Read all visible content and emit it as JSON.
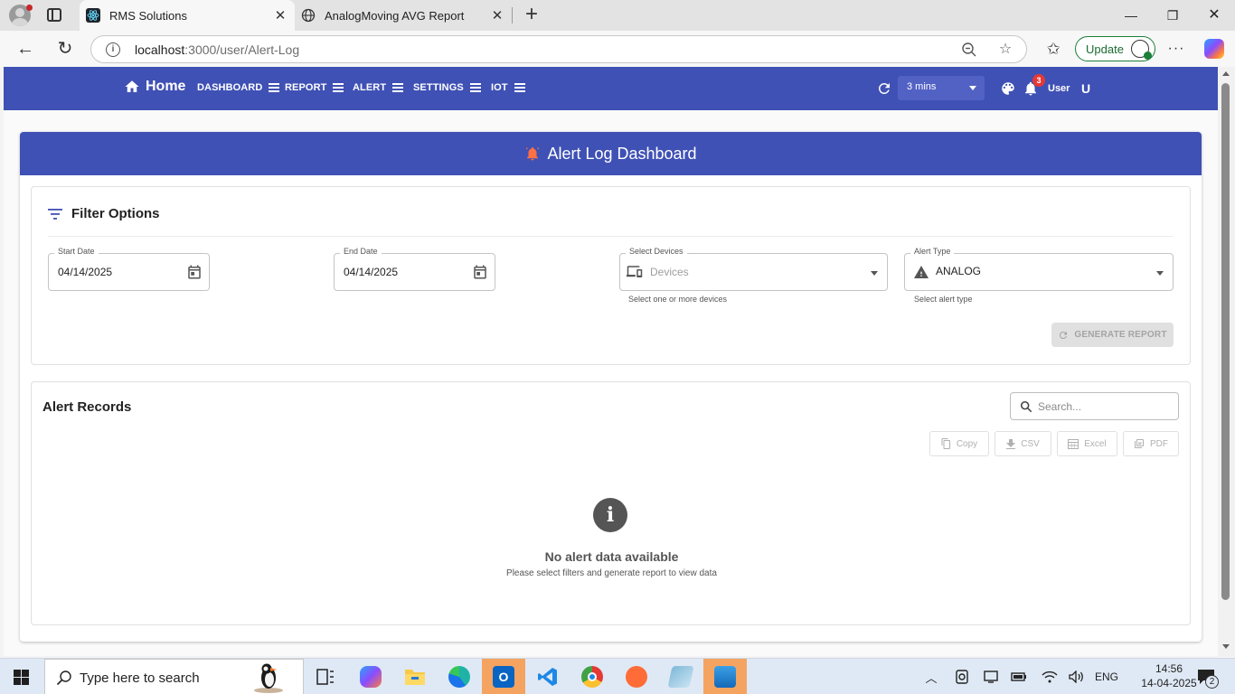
{
  "browser": {
    "tabs": [
      {
        "title": "RMS Solutions",
        "active": true,
        "icon": "react-icon"
      },
      {
        "title": "AnalogMoving AVG Report",
        "active": false,
        "icon": "globe-icon"
      }
    ],
    "url_host": "localhost",
    "url_path": ":3000/user/Alert-Log",
    "update_label": "Update"
  },
  "nav": {
    "home": "Home",
    "items": [
      "DASHBOARD",
      "REPORT",
      "ALERT",
      "SETTINGS",
      "IOT"
    ],
    "interval": "3 mins",
    "notification_count": "3",
    "user_label": "User",
    "user_initial": "U",
    "color": "#3f51b5"
  },
  "dashboard": {
    "title": "Alert Log Dashboard"
  },
  "filters": {
    "title": "Filter Options",
    "start_date": {
      "label": "Start Date",
      "value": "04/14/2025"
    },
    "end_date": {
      "label": "End Date",
      "value": "04/14/2025"
    },
    "devices": {
      "label": "Select Devices",
      "placeholder": "Devices",
      "help": "Select one or more devices"
    },
    "alert_type": {
      "label": "Alert Type",
      "value": "ANALOG",
      "help": "Select alert type"
    },
    "generate_label": "GENERATE REPORT"
  },
  "records": {
    "title": "Alert Records",
    "search_placeholder": "Search...",
    "exports": [
      "Copy",
      "CSV",
      "Excel",
      "PDF"
    ],
    "empty_title": "No alert data available",
    "empty_sub": "Please select filters and generate report to view data"
  },
  "taskbar": {
    "search_text": "Type here to search",
    "language": "ENG",
    "time": "14:56",
    "date": "14-04-2025",
    "notifications": "2"
  }
}
